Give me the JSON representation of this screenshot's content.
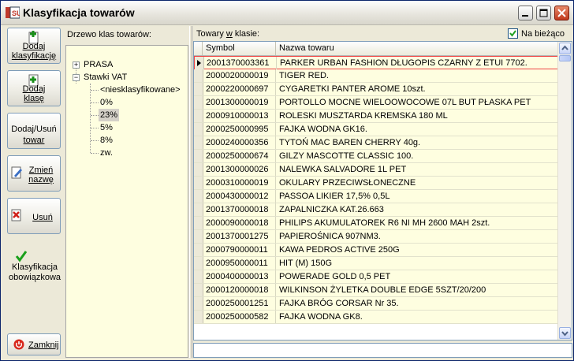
{
  "window": {
    "title": "Klasyfikacja towarów",
    "app_icon": "app-logo-icon",
    "controls": [
      "minimize-icon",
      "maximize-icon",
      "close-icon"
    ]
  },
  "toolbar": {
    "add_class": {
      "line1": "Dodaj",
      "line2": "klasyfikację"
    },
    "add_subclass": {
      "line1": "Dodaj",
      "line2": "klasę"
    },
    "add_remove_item": {
      "line1": "Dodaj/Usuń",
      "line2": "towar"
    },
    "rename": {
      "line1": "Zmień",
      "line2": "nazwę"
    },
    "delete": "Usuń",
    "mandatory": {
      "line1": "Klasyfikacja",
      "line2": "obowiązkowa"
    },
    "close": "Zamknij"
  },
  "tree": {
    "label": "Drzewo klas towarów:",
    "nodes": [
      {
        "label": "PRASA",
        "expander": "+"
      },
      {
        "label": "Stawki VAT",
        "expander": "−"
      },
      {
        "label": "<niesklasyfikowane>"
      },
      {
        "label": "0%"
      },
      {
        "label": "23%",
        "selected": true
      },
      {
        "label": "5%"
      },
      {
        "label": "8%"
      },
      {
        "label": "zw."
      }
    ]
  },
  "items": {
    "label_pre": "Towary ",
    "label_u": "w",
    "label_post": " klasie:",
    "current_checkbox_label": "Na bieżąco",
    "current_checked": true,
    "columns": [
      "Symbol",
      "Nazwa towaru"
    ],
    "rows": [
      [
        "2001370003361",
        "PARKER URBAN FASHION DŁUGOPIS CZARNY Z ETUI 7702."
      ],
      [
        "2000020000019",
        "TIGER RED."
      ],
      [
        "2000220000697",
        "CYGARETKI PANTER AROME 10szt."
      ],
      [
        "2001300000019",
        "PORTOLLO MOCNE WIELOOWOCOWE 07L BUT PŁASKA PET"
      ],
      [
        "2000910000013",
        "ROLESKI MUSZTARDA KREMSKA 180 ML"
      ],
      [
        "2000250000995",
        "FAJKA WODNA GK16."
      ],
      [
        "2000240000356",
        "TYTOŃ MAC BAREN CHERRY 40g."
      ],
      [
        "2000250000674",
        "GILZY MASCOTTE CLASSIC 100."
      ],
      [
        "2001300000026",
        "NALEWKA SALVADORE 1L PET"
      ],
      [
        "2000310000019",
        "OKULARY PRZECIWSŁONECZNE"
      ],
      [
        "2000430000012",
        "PASSOA LIKIER 17,5% 0,5L"
      ],
      [
        "2001370000018",
        "ZAPALNICZKA KAT.26.663"
      ],
      [
        "2000090000018",
        "PHILIPS AKUMULATOREK R6 NI MH 2600 MAH 2szt."
      ],
      [
        "2001370001275",
        "PAPIEROŚNICA 907NM3."
      ],
      [
        "2000790000011",
        "KAWA PEDROS ACTIVE 250G"
      ],
      [
        "2000950000011",
        "HIT  (M) 150G"
      ],
      [
        "2000400000013",
        "POWERADE GOLD 0,5 PET"
      ],
      [
        "2000120000018",
        "WILKINSON ŻYLETKA DOUBLE EDGE 5SZT/20/200"
      ],
      [
        "2000250001251",
        "FAJKA BRÓG CORSAR Nr 35."
      ],
      [
        "2000250000582",
        "FAJKA WODNA GK8."
      ]
    ]
  }
}
